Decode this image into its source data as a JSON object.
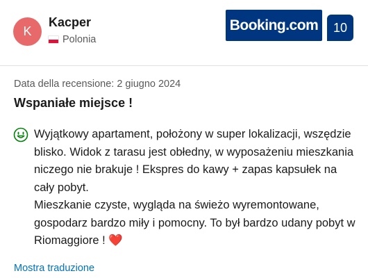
{
  "reviewer": {
    "initial": "K",
    "name": "Kacper",
    "country": "Polonia",
    "flag_icon": "poland-flag-icon"
  },
  "brand": {
    "logo_text": "Booking.com",
    "score": "10",
    "color": "#003580"
  },
  "review": {
    "date_text": "Data della recensione: 2 giugno 2024",
    "title": "Wspaniałe miejsce !",
    "sentiment_icon": "smile-icon",
    "paragraph_1": "Wyjątkowy apartament, położony w super lokalizacji, wszędzie blisko. Widok z tarasu jest obłedny, w wyposażeniu mieszkania niczego nie brakuje ! Ekspres do kawy + zapas kapsułek na cały pobyt.",
    "paragraph_2": "Mieszkanie czyste, wygląda na świeżo wyremontowane, gospodarz bardzo miły i pomocny. To był bardzo udany pobyt w Riomaggiore !",
    "heart": "❤️"
  },
  "actions": {
    "translate_label": "Mostra traduzione"
  }
}
